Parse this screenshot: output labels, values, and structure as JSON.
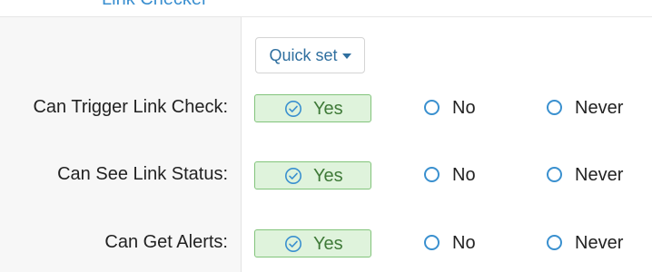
{
  "header": {
    "section_title": "Link Checker"
  },
  "toolbar": {
    "quick_set_label": "Quick set"
  },
  "permissions": [
    {
      "label": "Can Trigger Link Check:",
      "options": [
        "Yes",
        "No",
        "Never"
      ],
      "selected": "Yes"
    },
    {
      "label": "Can See Link Status:",
      "options": [
        "Yes",
        "No",
        "Never"
      ],
      "selected": "Yes"
    },
    {
      "label": "Can Get Alerts:",
      "options": [
        "Yes",
        "No",
        "Never"
      ],
      "selected": "Yes"
    }
  ],
  "colors": {
    "accent": "#3a90cf",
    "selected_bg": "#dff3dc",
    "selected_border": "#82c47b",
    "selected_text": "#3f7a38"
  },
  "icons": {
    "selected": "check-circle-icon",
    "unselected": "radio-empty-icon",
    "dropdown": "caret-down-icon"
  }
}
